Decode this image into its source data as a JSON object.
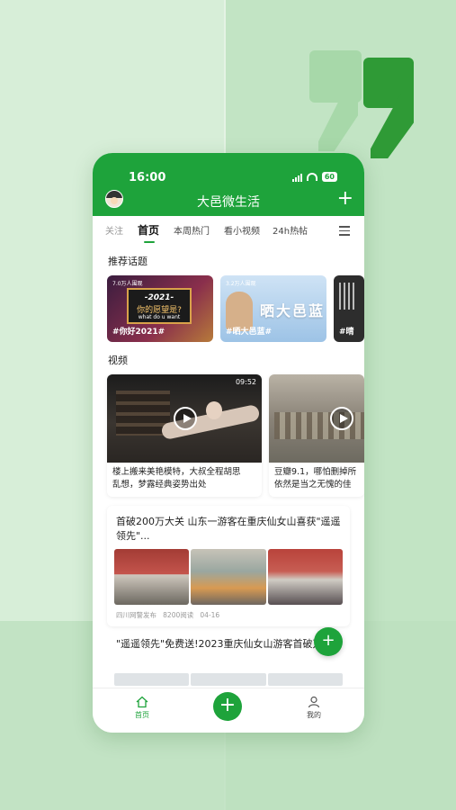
{
  "status": {
    "time": "16:00",
    "battery": "60"
  },
  "header": {
    "title": "大邑微生活",
    "plus": "+"
  },
  "tabs": [
    "关注",
    "首页",
    "本周热门",
    "看小视频",
    "24h热帖"
  ],
  "sections": {
    "topics": "推荐话题",
    "videos": "视频"
  },
  "topics": [
    {
      "count": "7.0万人围观",
      "tag": "#你好2021#",
      "line1": "-2021-",
      "line2": "你的愿望是?",
      "line3": "what do u want"
    },
    {
      "count": "3.2万人围观",
      "tag": "#晒大邑蓝#",
      "big": "晒大邑蓝"
    },
    {
      "count": "",
      "tag": "#晴"
    }
  ],
  "videos": [
    {
      "duration": "09:52",
      "title": "楼上搬来美艳模特，大叔全程胡思",
      "title2": "乱想，梦露经典姿势出处"
    },
    {
      "duration": "",
      "title": "豆瓣9.1，哪怕删掉所",
      "title2": "依然是当之无愧的佳"
    }
  ],
  "news": [
    {
      "title": "首破200万大关 山东一游客在重庆仙女山喜获\"遥遥领先\"...",
      "source": "四川网警发布",
      "reads": "8200阅读",
      "date": "04-16"
    },
    {
      "title": "\"遥遥领先\"免费送!2023重庆仙女山游客首破万"
    }
  ],
  "fab": "+",
  "bottom_nav": {
    "home": "首页",
    "add": "+",
    "me": "我的"
  },
  "colors": {
    "brand_green": "#1ea33b",
    "background": "#cfe9d0"
  }
}
